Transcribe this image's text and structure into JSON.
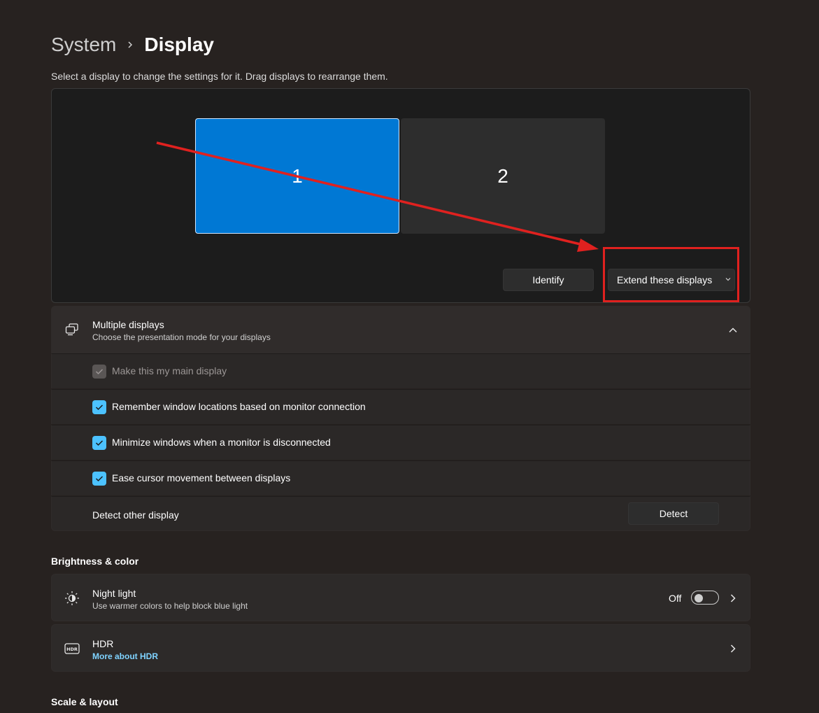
{
  "breadcrumb": {
    "parent": "System",
    "current": "Display"
  },
  "instruction": "Select a display to change the settings for it. Drag displays to rearrange them.",
  "arrangement": {
    "monitors": [
      {
        "label": "1",
        "selected": true
      },
      {
        "label": "2",
        "selected": false
      }
    ],
    "identify_label": "Identify",
    "mode_label": "Extend these displays"
  },
  "multiple_displays": {
    "title": "Multiple displays",
    "subtitle": "Choose the presentation mode for your displays",
    "expanded": true,
    "options": [
      {
        "label": "Make this my main display",
        "checked": true,
        "disabled": true
      },
      {
        "label": "Remember window locations based on monitor connection",
        "checked": true,
        "disabled": false
      },
      {
        "label": "Minimize windows when a monitor is disconnected",
        "checked": true,
        "disabled": false
      },
      {
        "label": "Ease cursor movement between displays",
        "checked": true,
        "disabled": false
      }
    ],
    "detect_label": "Detect other display",
    "detect_button": "Detect"
  },
  "brightness_heading": "Brightness & color",
  "night_light": {
    "title": "Night light",
    "subtitle": "Use warmer colors to help block blue light",
    "state": "Off"
  },
  "hdr": {
    "title": "HDR",
    "link": "More about HDR"
  },
  "scale_heading": "Scale & layout",
  "colors": {
    "accent": "#0078d4",
    "checkbox_accent": "#4cc2ff",
    "annotation": "#e0211f",
    "link": "#7fd3ff"
  }
}
